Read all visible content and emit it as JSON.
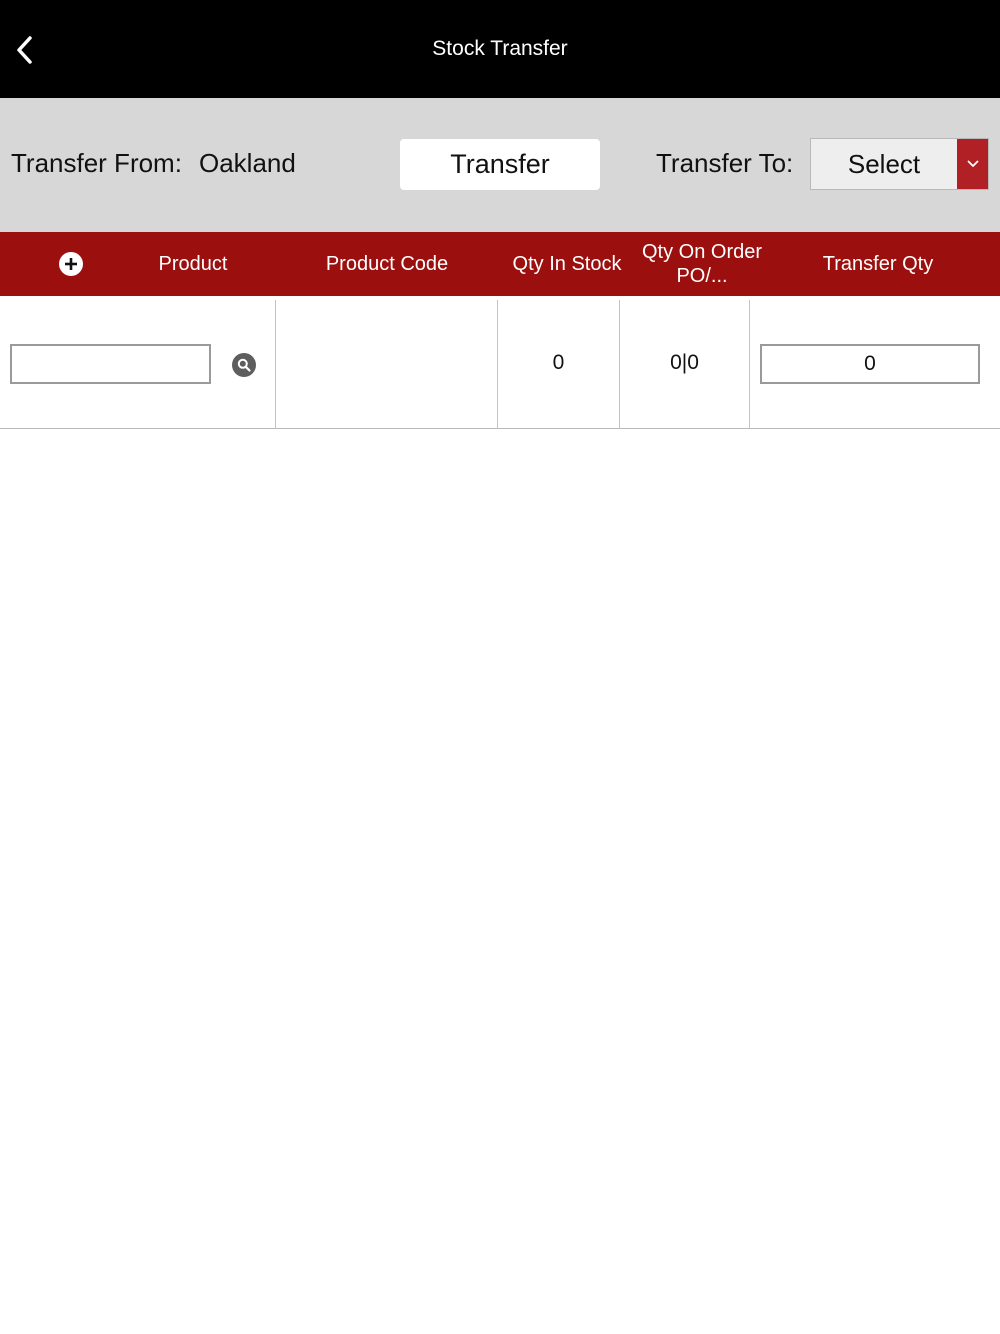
{
  "navbar": {
    "title": "Stock Transfer",
    "back_icon": "chevron-left-icon"
  },
  "controls": {
    "from_label": "Transfer From:",
    "from_value": "Oakland",
    "transfer_button": "Transfer",
    "to_label": "Transfer To:",
    "to_select_value": "Select",
    "accent_color": "#b12024"
  },
  "table": {
    "header_color": "#9b0f0f",
    "columns": [
      "Product",
      "Product Code",
      "Qty In Stock",
      "Qty On Order PO/...",
      "Transfer Qty"
    ],
    "rows": [
      {
        "product": "",
        "product_code": "",
        "qty_in_stock": "0",
        "qty_on_order": "0|0",
        "transfer_qty": "0"
      }
    ]
  }
}
